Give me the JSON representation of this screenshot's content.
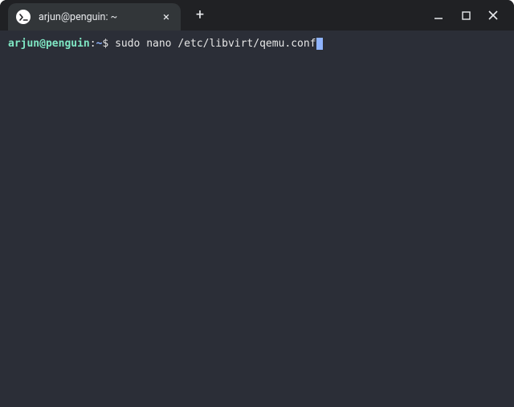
{
  "tab": {
    "title": "arjun@penguin: ~"
  },
  "prompt": {
    "userhost": "arjun@penguin",
    "colon": ":",
    "path": "~",
    "dollar": "$ ",
    "command": "sudo nano /etc/libvirt/qemu.conf"
  },
  "icons": {
    "terminal": "terminal-icon",
    "close": "×",
    "plus": "+"
  }
}
